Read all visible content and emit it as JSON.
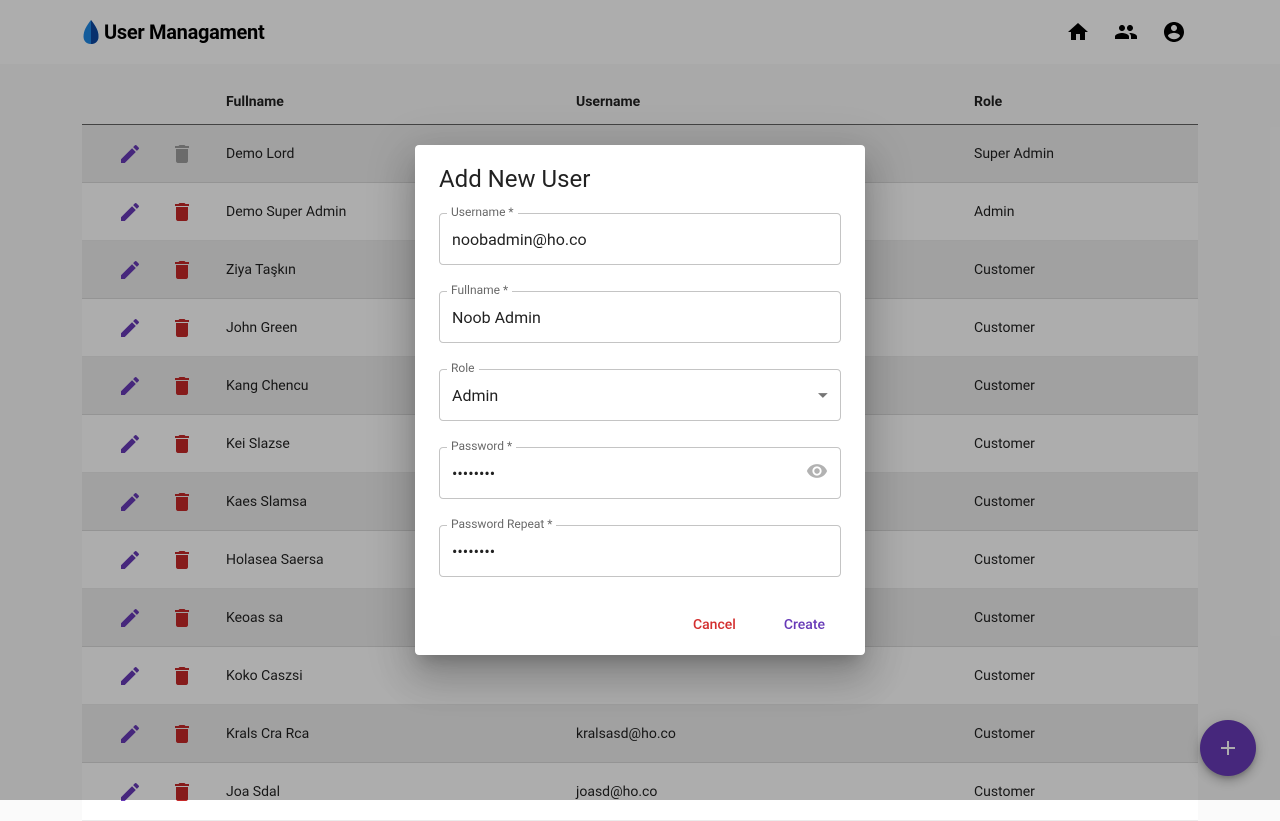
{
  "header": {
    "title": "User Managament"
  },
  "table": {
    "columns": {
      "fullname": "Fullname",
      "username": "Username",
      "role": "Role"
    },
    "rows": [
      {
        "fullname": "Demo Lord",
        "username": "",
        "role": "Super Admin",
        "deletable": false
      },
      {
        "fullname": "Demo Super Admin",
        "username": "",
        "role": "Admin",
        "deletable": true
      },
      {
        "fullname": "Ziya Taşkın",
        "username": "",
        "role": "Customer",
        "deletable": true
      },
      {
        "fullname": "John Green",
        "username": "",
        "role": "Customer",
        "deletable": true
      },
      {
        "fullname": "Kang Chencu",
        "username": "",
        "role": "Customer",
        "deletable": true
      },
      {
        "fullname": "Kei Slazse",
        "username": "",
        "role": "Customer",
        "deletable": true
      },
      {
        "fullname": "Kaes Slamsa",
        "username": "",
        "role": "Customer",
        "deletable": true
      },
      {
        "fullname": "Holasea Saersa",
        "username": "",
        "role": "Customer",
        "deletable": true
      },
      {
        "fullname": "Keoas sa",
        "username": "",
        "role": "Customer",
        "deletable": true
      },
      {
        "fullname": "Koko Caszsi",
        "username": "",
        "role": "Customer",
        "deletable": true
      },
      {
        "fullname": "Krals Cra Rca",
        "username": "kralsasd@ho.co",
        "role": "Customer",
        "deletable": true
      },
      {
        "fullname": "Joa Sdal",
        "username": "joasd@ho.co",
        "role": "Customer",
        "deletable": true
      }
    ]
  },
  "dialog": {
    "title": "Add New User",
    "fields": {
      "username": {
        "label": "Username *",
        "value": "noobadmin@ho.co"
      },
      "fullname": {
        "label": "Fullname *",
        "value": "Noob Admin"
      },
      "role": {
        "label": "Role",
        "value": "Admin"
      },
      "password": {
        "label": "Password *",
        "value": "••••••••"
      },
      "password_repeat": {
        "label": "Password Repeat *",
        "value": "••••••••"
      }
    },
    "actions": {
      "cancel": "Cancel",
      "create": "Create"
    }
  }
}
